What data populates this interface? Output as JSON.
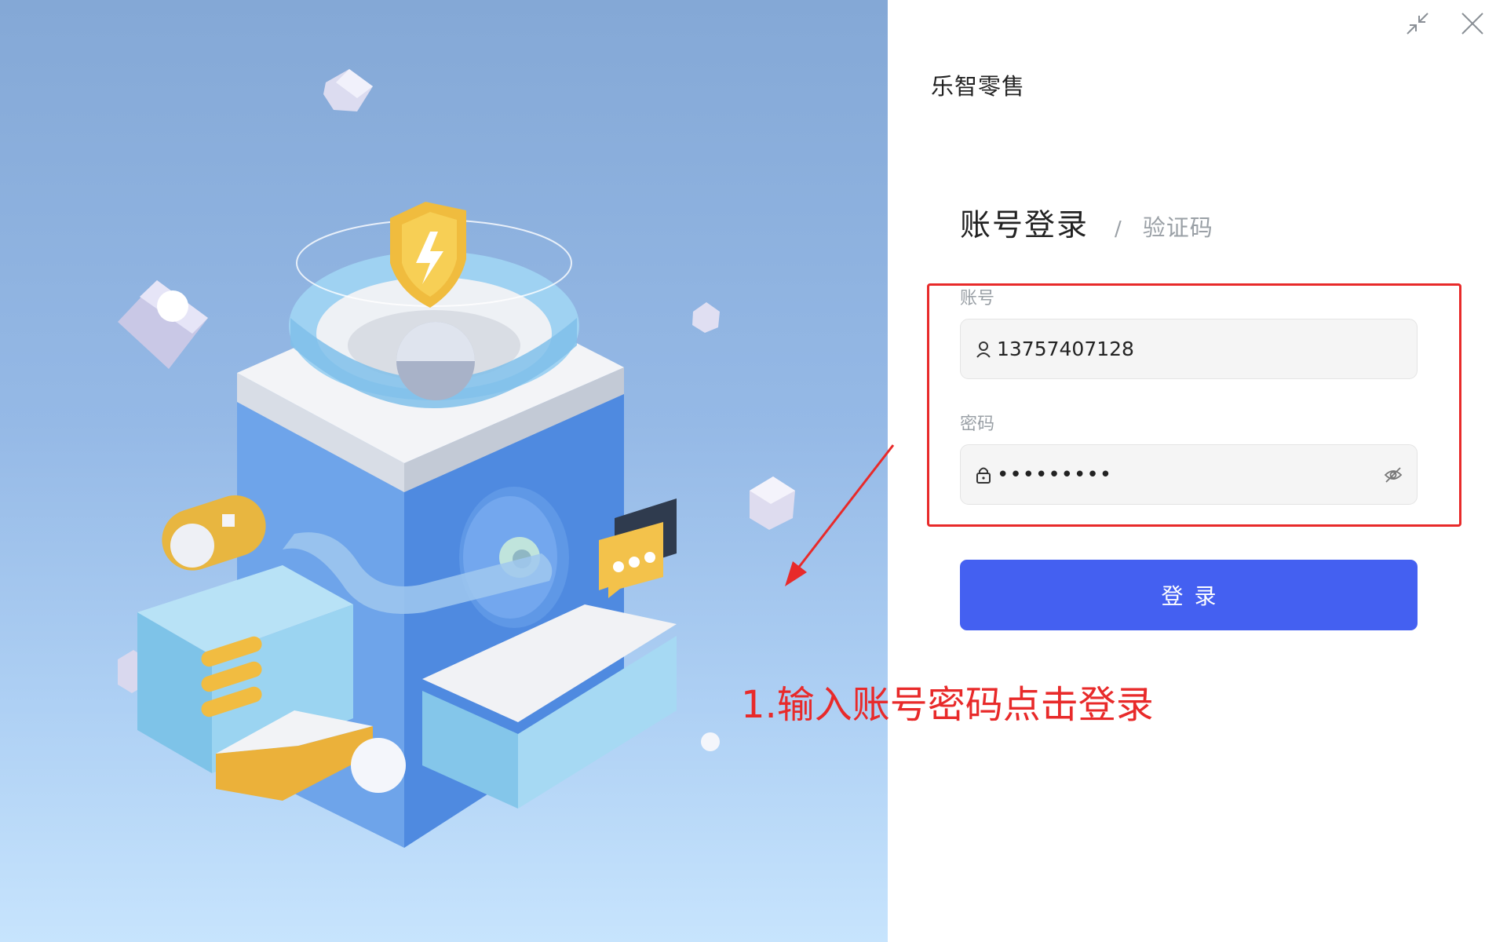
{
  "window": {
    "minimize_icon": "collapse-arrows-icon",
    "close_icon": "close-icon"
  },
  "brand": {
    "name": "乐智零售"
  },
  "login": {
    "tab_active": "账号登录",
    "tab_separator": "/",
    "tab_inactive": "验证码",
    "account": {
      "label": "账号",
      "value": "13757407128",
      "icon": "user-icon"
    },
    "password": {
      "label": "密码",
      "value": "•••••••••",
      "icon": "lock-icon",
      "toggle_icon": "eye-off-icon"
    },
    "submit_label": "登录"
  },
  "annotation": {
    "text": "1.输入账号密码点击登录",
    "color": "#e82a2a"
  },
  "colors": {
    "accent": "#4460f1",
    "hero_top": "#84a8d6",
    "hero_bottom": "#c7e4fd"
  }
}
